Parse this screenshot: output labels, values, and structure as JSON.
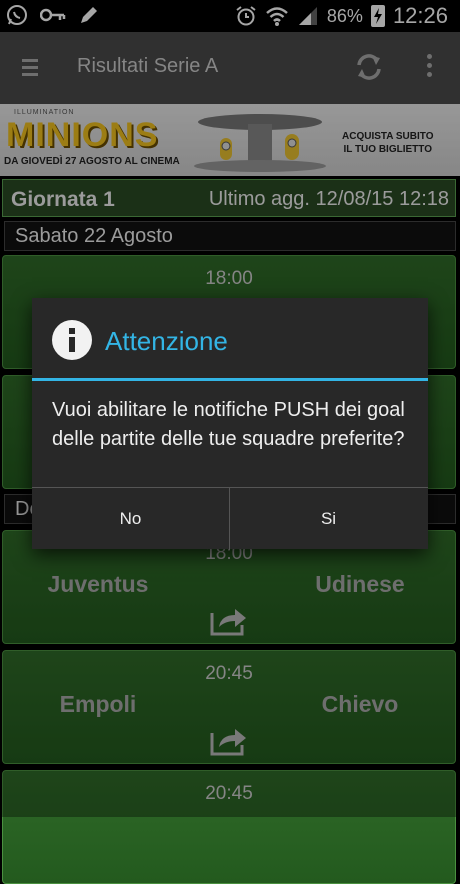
{
  "status_bar": {
    "battery": "86%",
    "time": "12:26",
    "icons": [
      "whatsapp-icon",
      "key-icon",
      "pencil-icon",
      "alarm-icon",
      "wifi-icon",
      "signal-icon",
      "battery-charging-icon"
    ]
  },
  "app_bar": {
    "title": "Risultati Serie A",
    "icons": [
      "menu-icon",
      "refresh-icon",
      "overflow-menu-icon"
    ]
  },
  "ad_banner": {
    "brand_small": "ILLUMINATION",
    "brand": "MINIONS",
    "date_text": "DA GIOVEDÌ 27 AGOSTO AL CINEMA",
    "cta_line1": "ACQUISTA SUBITO",
    "cta_line2": "IL TUO BIGLIETTO"
  },
  "round": {
    "name": "Giornata 1",
    "updated": "Ultimo agg. 12/08/15 12:18"
  },
  "date_sections": [
    {
      "label": "Sabato 22 Agosto"
    },
    {
      "label": "De"
    }
  ],
  "matches": [
    {
      "time": "18:00",
      "home": "",
      "away": ""
    },
    {
      "time": "",
      "home": "",
      "away": ""
    },
    {
      "time": "18:00",
      "home": "Juventus",
      "away": "Udinese"
    },
    {
      "time": "20:45",
      "home": "Empoli",
      "away": "Chievo"
    },
    {
      "time": "20:45",
      "home": "",
      "away": ""
    }
  ],
  "dialog": {
    "title": "Attenzione",
    "message": "Vuoi abilitare le notifiche PUSH dei goal delle partite delle tue squadre preferite?",
    "buttons": {
      "no": "No",
      "yes": "Si"
    }
  },
  "colors": {
    "accent": "#33b5e5",
    "match_bg": "#2f6a28",
    "dialog_bg": "#282828"
  }
}
